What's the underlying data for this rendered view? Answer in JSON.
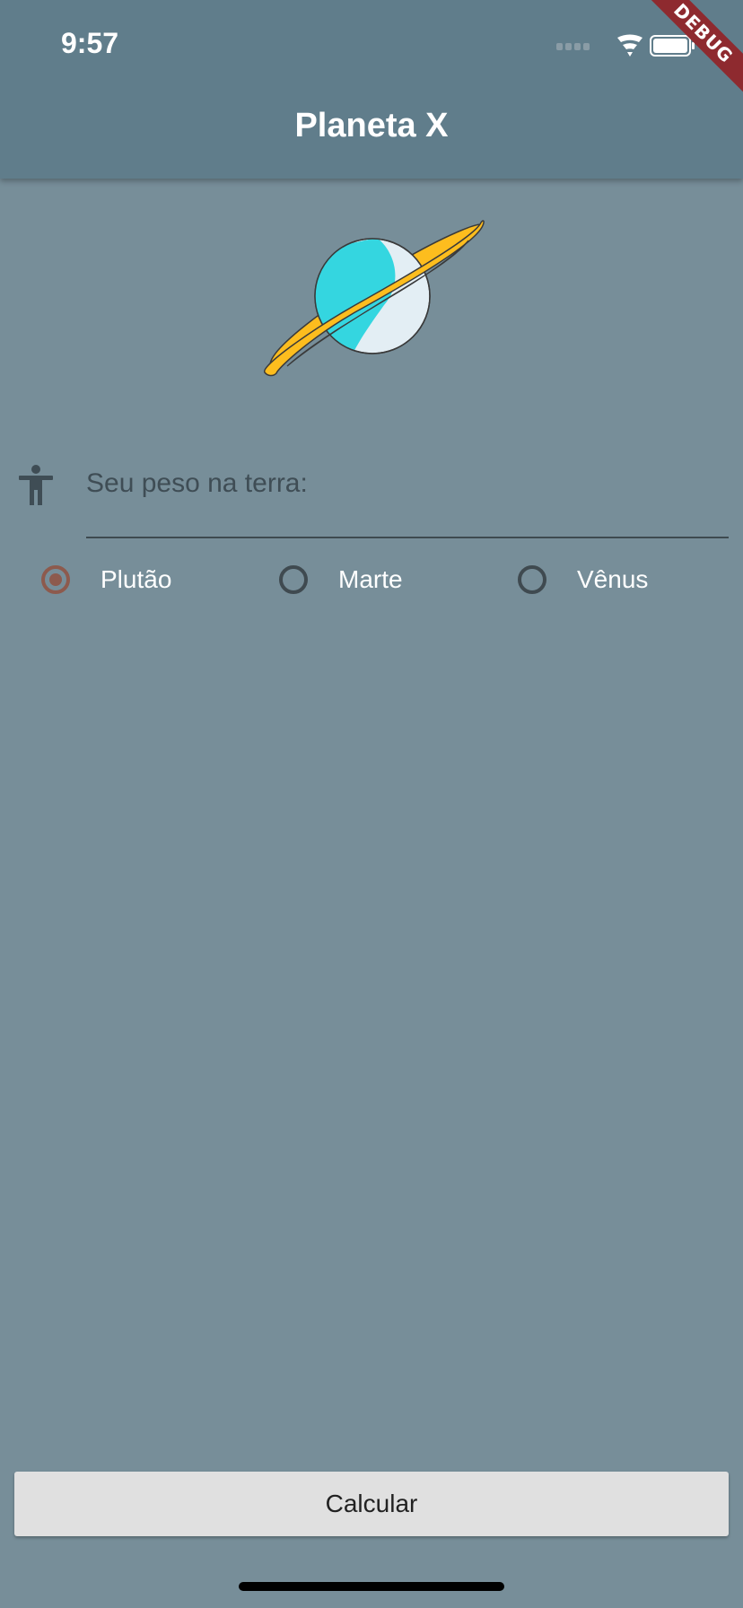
{
  "status_bar": {
    "time": "9:57",
    "icons": [
      "signal-dots-icon",
      "wifi-icon",
      "battery-icon"
    ]
  },
  "app_bar": {
    "title": "Planeta X",
    "color": "#607D8B"
  },
  "debug_banner": {
    "text": "DEBUG"
  },
  "form": {
    "weight_field": {
      "placeholder": "Seu peso na terra:",
      "value": "",
      "icon": "person-icon"
    },
    "planets": [
      {
        "label": "Plutão",
        "selected": true
      },
      {
        "label": "Marte",
        "selected": false
      },
      {
        "label": "Vênus",
        "selected": false
      }
    ]
  },
  "actions": {
    "calculate_label": "Calcular"
  },
  "colors": {
    "background": "#778E99",
    "appbar": "#607D8B",
    "radio_selected": "#8D5A4D",
    "radio_unselected": "#3F4A50",
    "button": "#E0E0E0"
  }
}
